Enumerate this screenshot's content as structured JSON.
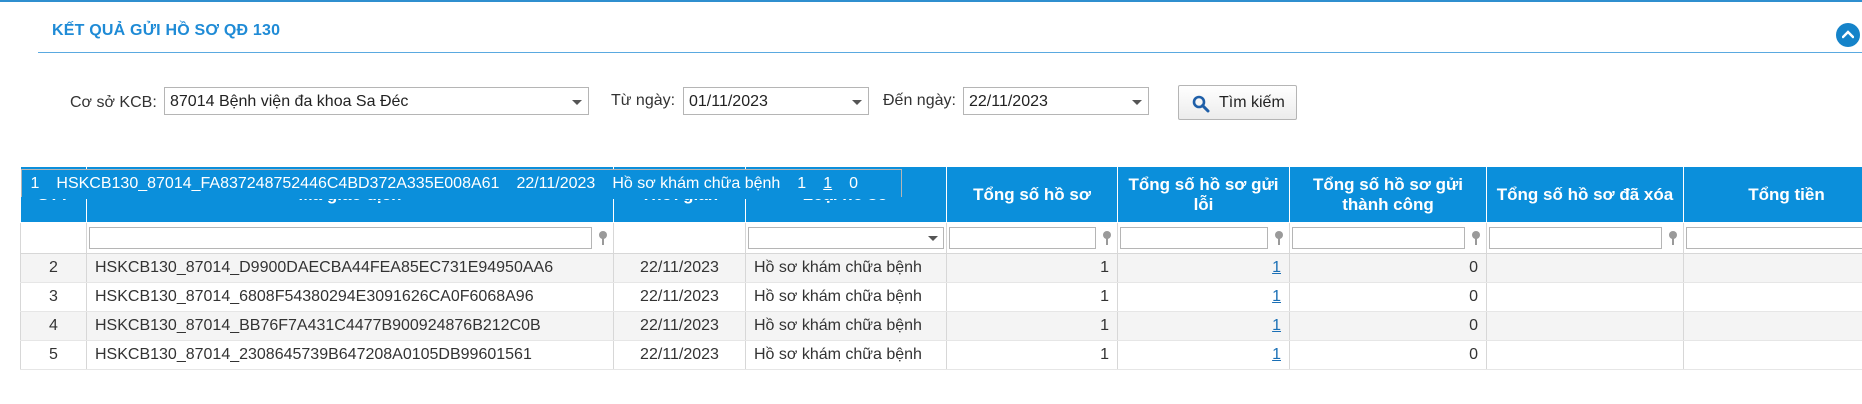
{
  "panel": {
    "title": "KẾT QUẢ GỬI HỒ SƠ QĐ 130"
  },
  "filters": {
    "facility_label": "Cơ sở KCB:",
    "facility_value": "87014 Bệnh viện đa khoa Sa Đéc",
    "from_label": "Từ ngày:",
    "from_value": "01/11/2023",
    "to_label": "Đến ngày:",
    "to_value": "22/11/2023",
    "search_label": "Tìm kiếm"
  },
  "table": {
    "headers": [
      "STT",
      "Mã giao dịch",
      "Thời gian",
      "Loại hồ sơ",
      "Tổng số hồ sơ",
      "Tổng số hồ sơ gửi lỗi",
      "Tổng số hồ sơ gửi thành công",
      "Tổng số hồ sơ đã xóa",
      "Tổng tiền"
    ],
    "rows": [
      {
        "stt": "1",
        "ma": "HSKCB130_87014_FA837248752446C4BD372A335E008A61",
        "time": "22/11/2023",
        "type": "Hồ sơ khám chữa bệnh",
        "total": "1",
        "error": "1",
        "success": "0",
        "deleted": "",
        "amount": ""
      },
      {
        "stt": "2",
        "ma": "HSKCB130_87014_D9900DAECBA44FEA85EC731E94950AA6",
        "time": "22/11/2023",
        "type": "Hồ sơ khám chữa bệnh",
        "total": "1",
        "error": "1",
        "success": "0",
        "deleted": "",
        "amount": ""
      },
      {
        "stt": "3",
        "ma": "HSKCB130_87014_6808F54380294E3091626CA0F6068A96",
        "time": "22/11/2023",
        "type": "Hồ sơ khám chữa bệnh",
        "total": "1",
        "error": "1",
        "success": "0",
        "deleted": "",
        "amount": ""
      },
      {
        "stt": "4",
        "ma": "HSKCB130_87014_BB76F7A431C4477B900924876B212C0B",
        "time": "22/11/2023",
        "type": "Hồ sơ khám chữa bệnh",
        "total": "1",
        "error": "1",
        "success": "0",
        "deleted": "",
        "amount": ""
      },
      {
        "stt": "5",
        "ma": "HSKCB130_87014_2308645739B647208A0105DB99601561",
        "time": "22/11/2023",
        "type": "Hồ sơ khám chữa bệnh",
        "total": "1",
        "error": "1",
        "success": "0",
        "deleted": "",
        "amount": ""
      }
    ]
  },
  "icons": {
    "collapse": "chevron-up-icon",
    "search": "search-icon",
    "filter": "pin-icon"
  },
  "colors": {
    "accent": "#0b8fdb",
    "title": "#1f8bd6",
    "link": "#1a6fb5"
  }
}
